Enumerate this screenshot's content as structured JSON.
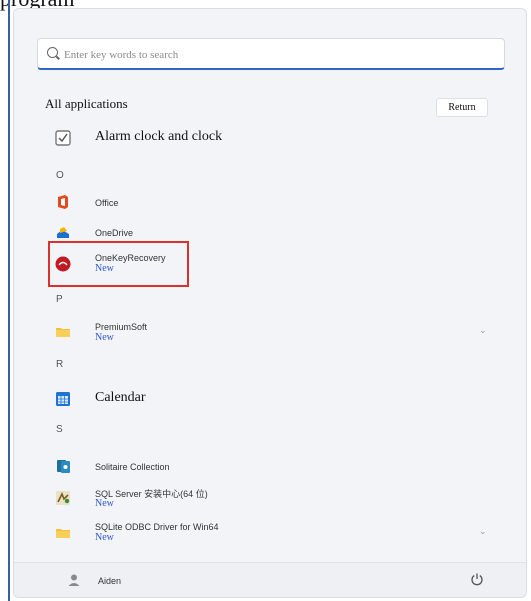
{
  "caption": "program",
  "search": {
    "placeholder": "Enter key words to search"
  },
  "header": {
    "title": "All applications",
    "return_label": "Return"
  },
  "letters": [
    "O",
    "P",
    "R",
    "S"
  ],
  "apps": [
    {
      "name": "Alarm clock and clock",
      "icon": "alarm-clock-icon"
    },
    {
      "name": "Office",
      "icon": "office-icon"
    },
    {
      "name": "OneDrive",
      "icon": "onedrive-icon"
    },
    {
      "name": "OneKeyRecovery",
      "icon": "onekeyrecovery-icon",
      "tag": "New"
    },
    {
      "name": "PremiumSoft",
      "icon": "folder-icon",
      "tag": "New"
    },
    {
      "name": "Calendar",
      "icon": "calendar-icon"
    },
    {
      "name": "Solitaire Collection",
      "icon": "solitaire-icon"
    },
    {
      "name": "SQL Server 安装中心(64 位)",
      "icon": "sql-server-icon",
      "tag": "New"
    },
    {
      "name": "SQLite ODBC Driver for Win64",
      "icon": "folder-icon",
      "tag": "New"
    }
  ],
  "footer": {
    "user": "Aiden"
  },
  "colors": {
    "accent": "#2e66c9",
    "highlight": "#d9312b",
    "new_tag": "#2e59c9"
  }
}
